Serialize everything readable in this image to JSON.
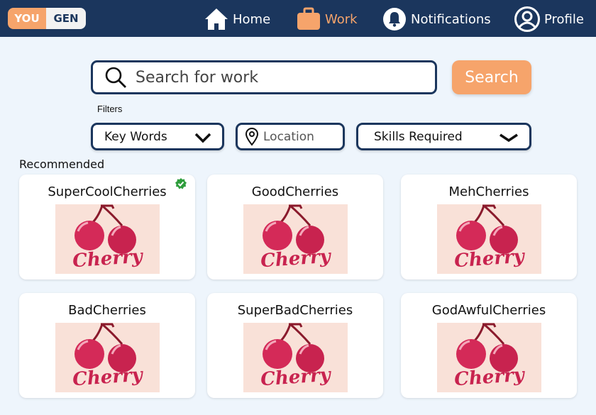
{
  "header": {
    "logo_left": "YOU",
    "logo_right": "GEN",
    "nav": [
      {
        "label": "Home",
        "icon": "home-icon"
      },
      {
        "label": "Work",
        "icon": "briefcase-icon",
        "active": true
      },
      {
        "label": "Notifications",
        "icon": "bell-icon"
      },
      {
        "label": "Profile",
        "icon": "user-icon"
      }
    ]
  },
  "search": {
    "placeholder": "Search for work",
    "button_label": "Search"
  },
  "filters": {
    "label": "Filters",
    "key_words": "Key Words",
    "location_placeholder": "Location",
    "skills": "Skills Required"
  },
  "recommended": {
    "label": "Recommended",
    "cards": [
      {
        "title": "SuperCoolCherries",
        "verified": true,
        "brand": "Cherry"
      },
      {
        "title": "GoodCherries",
        "verified": false,
        "brand": "Cherry"
      },
      {
        "title": "MehCherries",
        "verified": false,
        "brand": "Cherry"
      },
      {
        "title": "BadCherries",
        "verified": false,
        "brand": "Cherry"
      },
      {
        "title": "SuperBadCherries",
        "verified": false,
        "brand": "Cherry"
      },
      {
        "title": "GodAwfulCherries",
        "verified": false,
        "brand": "Cherry"
      }
    ]
  },
  "colors": {
    "navy": "#1b365d",
    "accent": "#f6a46b",
    "background": "#eef5fc",
    "cherry": "#c8234f",
    "verified_green": "#2e9d3c"
  }
}
